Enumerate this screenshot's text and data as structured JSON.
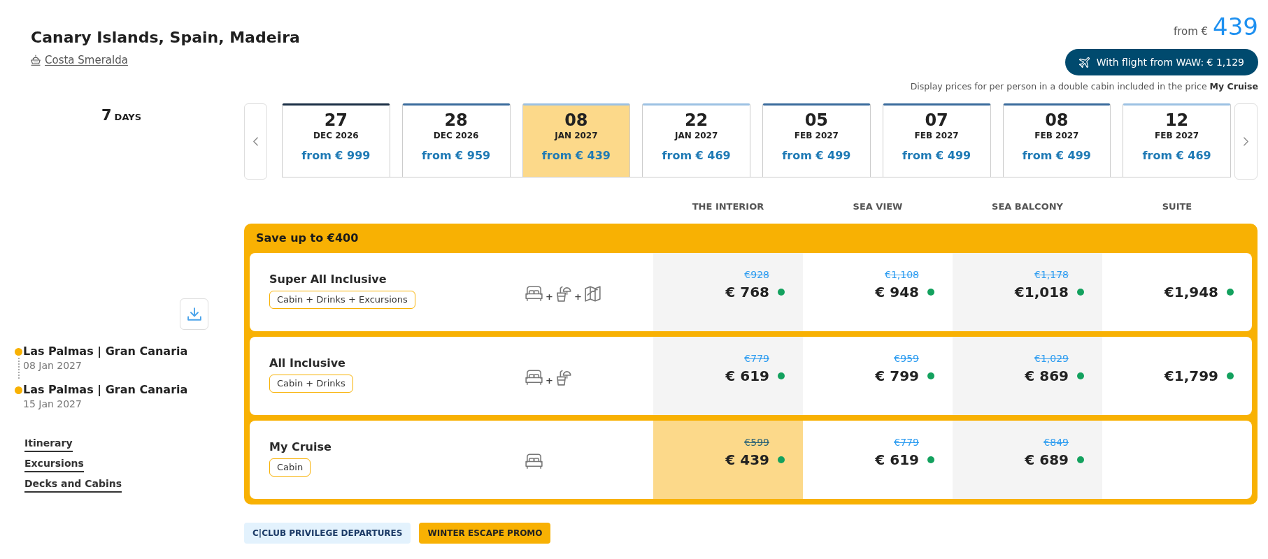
{
  "header": {
    "title": "Canary Islands, Spain, Madeira",
    "ship": "Costa Smeralda",
    "price": {
      "label": "from €",
      "amount": "439"
    },
    "flight_button": "With flight from WAW: € 1,129",
    "note": "Display prices for per person in a double cabin included in the price **My Cruise**"
  },
  "duration": {
    "number": "7",
    "unit": "DAYS"
  },
  "itinerary": [
    {
      "port": "Las Palmas | Gran Canaria",
      "date": "08 Jan 2027"
    },
    {
      "port": "Las Palmas | Gran Canaria",
      "date": "15 Jan 2027"
    }
  ],
  "links": [
    "Itinerary",
    "Excursions",
    "Decks and Cabins"
  ],
  "dates": [
    {
      "day": "27",
      "month": "DEC 2026",
      "price": "from € 999",
      "color": "#1b2f45",
      "selected": false
    },
    {
      "day": "28",
      "month": "DEC 2026",
      "price": "from € 959",
      "color": "#3a6b9c",
      "selected": false
    },
    {
      "day": "08",
      "month": "JAN 2027",
      "price": "from € 439",
      "color": "#9cc1e3",
      "selected": true
    },
    {
      "day": "22",
      "month": "JAN 2027",
      "price": "from € 469",
      "color": "#9cc1e3",
      "selected": false
    },
    {
      "day": "05",
      "month": "FEB 2027",
      "price": "from € 499",
      "color": "#3a6b9c",
      "selected": false
    },
    {
      "day": "07",
      "month": "FEB 2027",
      "price": "from € 499",
      "color": "#3a6b9c",
      "selected": false
    },
    {
      "day": "08",
      "month": "FEB 2027",
      "price": "from € 499",
      "color": "#3a6b9c",
      "selected": false
    },
    {
      "day": "12",
      "month": "FEB 2027",
      "price": "from € 469",
      "color": "#9cc1e3",
      "selected": false
    }
  ],
  "fares": {
    "banner": "Save up to €400",
    "columns": [
      "THE INTERIOR",
      "SEA VIEW",
      "SEA BALCONY",
      "SUITE"
    ],
    "rows": [
      {
        "name": "Super All Inclusive",
        "tag": "Cabin + Drinks + Excursions",
        "amenities": [
          {
            "kind": "cabin"
          },
          {
            "kind": "drinks",
            "joiner": "+"
          },
          {
            "kind": "excursions",
            "joiner": "+"
          }
        ],
        "prices": [
          {
            "old": "€928",
            "price": "€ 768",
            "color": "#13a15e",
            "selected": false
          },
          {
            "old": "€1,108",
            "price": "€ 948",
            "color": "#13a15e",
            "selected": false
          },
          {
            "old": "€1,178",
            "price": "€1,018",
            "color": "#13a15e",
            "selected": false
          },
          {
            "price": "€1,948",
            "color": "#13a15e",
            "selected": false
          }
        ]
      },
      {
        "name": "All Inclusive",
        "tag": "Cabin + Drinks",
        "amenities": [
          {
            "kind": "cabin"
          },
          {
            "kind": "drinks",
            "joiner": "+"
          }
        ],
        "prices": [
          {
            "old": "€779",
            "price": "€ 619",
            "color": "#13a15e",
            "selected": false
          },
          {
            "old": "€959",
            "price": "€ 799",
            "color": "#13a15e",
            "selected": false
          },
          {
            "old": "€1,029",
            "price": "€ 869",
            "color": "#13a15e",
            "selected": false
          },
          {
            "price": "€1,799",
            "color": "#13a15e",
            "selected": false
          }
        ]
      },
      {
        "name": "My Cruise",
        "tag": "Cabin",
        "amenities": [
          {
            "kind": "cabin"
          }
        ],
        "prices": [
          {
            "old": "€599",
            "price": "€ 439",
            "color": "#13a15e",
            "selected": true
          },
          {
            "old": "€779",
            "price": "€ 619",
            "color": "#13a15e",
            "selected": false
          },
          {
            "old": "€849",
            "price": "€ 689",
            "color": "#13a15e",
            "selected": false
          }
        ]
      }
    ]
  },
  "tags": [
    {
      "kind": "club",
      "label": "C|CLUB PRIVILEGE DEPARTURES"
    },
    {
      "kind": "promo",
      "label": "WINTER ESCAPE PROMO"
    }
  ]
}
